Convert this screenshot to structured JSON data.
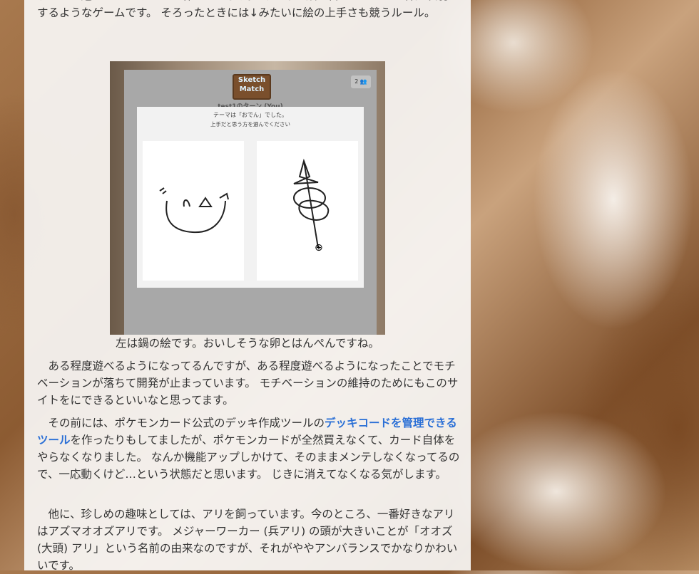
{
  "article": {
    "paragraph_intro": "ゲームが遊べるWebサイトを作っています。 みんなで絵を書いて、それで神経衰弱をするようなゲームです。 そろったときには↓みたいに絵の上手さも競うルール。",
    "figure": {
      "logo_line1": "Sketch",
      "logo_line2": "Match",
      "user_count": "2",
      "turn_label": "test1のターン (You)",
      "theme_text": "テーマは「おでん」でした。",
      "instruction_text": "上手だと思う方を選んでください"
    },
    "caption": "左は鍋の絵です。おいしそうな卵とはんぺんですね。",
    "paragraph_2": "ある程度遊べるようになってるんですが、ある程度遊べるようになったことでモチベーションが落ちて開発が止まっています。 モチベーションの維持のためにもこのサイトをにできるといいなと思ってます。",
    "paragraph_3_before": "その前には、ポケモンカード公式のデッキ作成ツールの",
    "paragraph_3_link": "デッキコードを管理できるツール",
    "paragraph_3_after": "を作ったりもしてましたが、ポケモンカードが全然買えなくて、カード自体をやらなくなりました。 なんか機能アップしかけて、そのままメンテしなくなってるので、一応動くけど…という状態だと思います。 じきに消えてなくなる気がします。",
    "paragraph_4": "他に、珍しめの趣味としては、アリを飼っています。今のところ、一番好きなアリはアズマオオズアリです。 メジャーワーカー (兵アリ) の頭が大きいことが「オオズ (大頭) アリ」という名前の由来なのですが、それがややアンバランスでかなりかわいいです。"
  },
  "colors": {
    "link": "#2a6fd6",
    "text": "#333333"
  }
}
